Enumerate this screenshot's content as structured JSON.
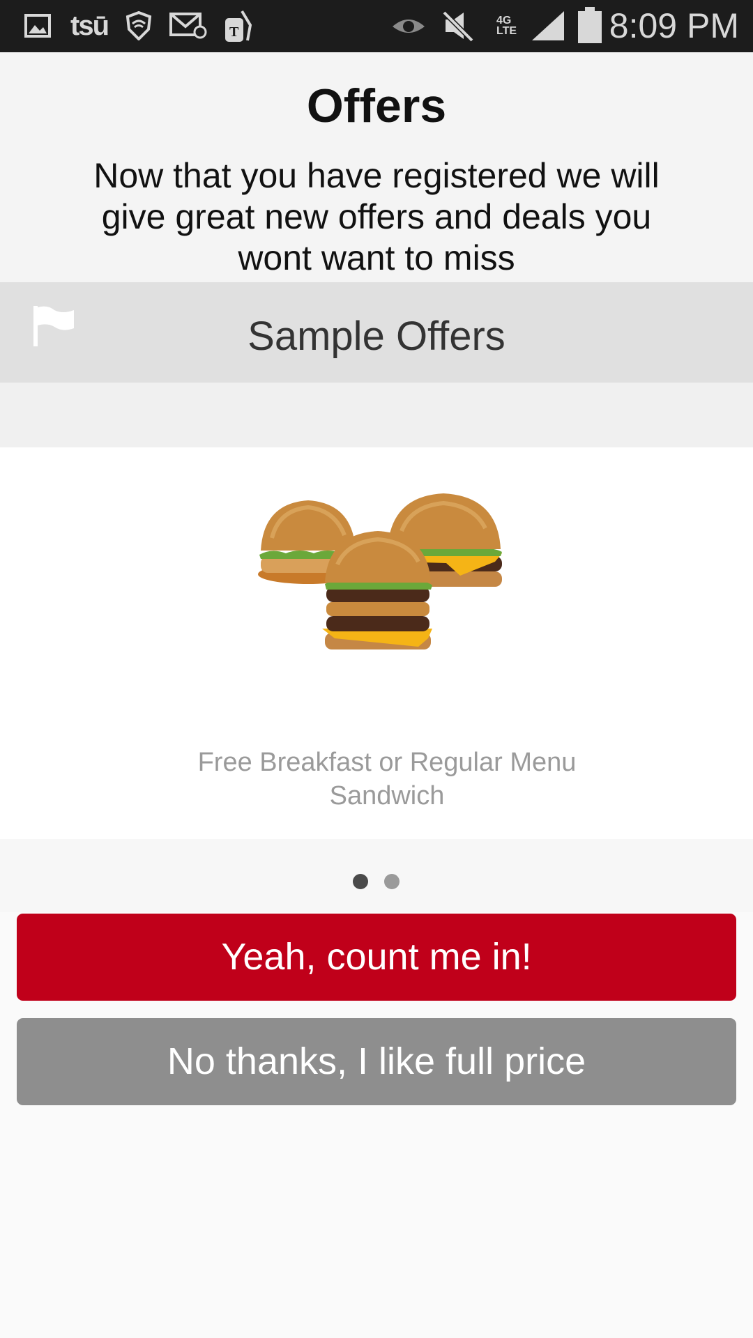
{
  "status_bar": {
    "time": "8:09 PM",
    "tsu_label": "tsū",
    "network_label": "4G LTE",
    "icons": [
      "gallery-icon",
      "tsu-icon",
      "shield-icon",
      "mail-icon",
      "tmobile-icon",
      "eye-icon",
      "mute-icon",
      "network-4g-icon",
      "signal-icon",
      "battery-icon"
    ]
  },
  "header": {
    "title": "Offers",
    "subtitle": "Now that you have registered we will give great new offers and deals you wont want to miss"
  },
  "section": {
    "label": "Sample Offers",
    "icon": "flag-icon"
  },
  "offer": {
    "image": "burgers-image",
    "text": "Free Breakfast or Regular Menu Sandwich"
  },
  "pager": {
    "count": 2,
    "active_index": 0,
    "active_color": "#4a4a4a",
    "inactive_color": "#9a9a9a"
  },
  "actions": {
    "accept_label": "Yeah, count me in!",
    "decline_label": "No thanks, I like full price",
    "accept_color": "#c0001a",
    "decline_color": "#8e8e8e"
  }
}
